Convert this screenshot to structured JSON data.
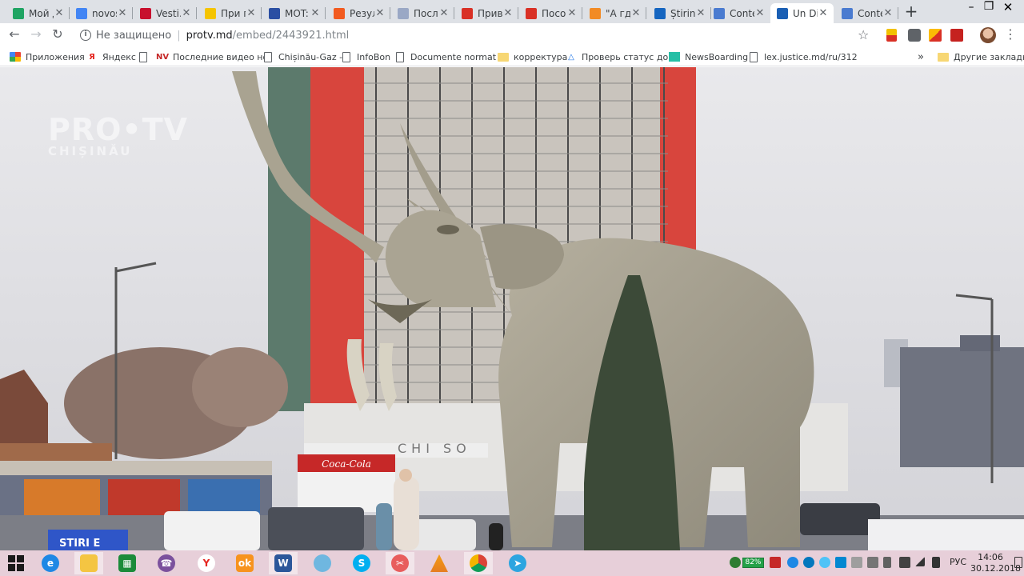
{
  "browser": {
    "tabs": [
      {
        "title": "Мой д",
        "icon": "google-drive-icon",
        "color": "#1fa463"
      },
      {
        "title": "novos",
        "icon": "google-docs-icon",
        "color": "#4285f4"
      },
      {
        "title": "Vesti.",
        "icon": "vesti-icon",
        "color": "#c8102e"
      },
      {
        "title": "При п",
        "icon": "tsn-icon",
        "color": "#f5c400"
      },
      {
        "title": "MOT:",
        "icon": "motor-icon",
        "color": "#2b4fa3"
      },
      {
        "title": "Резул",
        "icon": "orange-dot-icon",
        "color": "#f25a1f"
      },
      {
        "title": "После",
        "icon": "page-icon",
        "color": "#9aa8c5"
      },
      {
        "title": "Приві",
        "icon": "chart-icon",
        "color": "#d93025"
      },
      {
        "title": "Посо",
        "icon": "gmail-icon",
        "color": "#d93025"
      },
      {
        "title": "\"А гдє",
        "icon": "rocket-icon",
        "color": "#f28b25"
      },
      {
        "title": "Știrin",
        "icon": "stiri-icon",
        "color": "#1565c0"
      },
      {
        "title": "Conte",
        "icon": "legal-icon",
        "color": "#4a7bd0"
      },
      {
        "title": "Un Di",
        "icon": "protv-icon",
        "color": "#1a5fb4",
        "active": true
      },
      {
        "title": "Conte",
        "icon": "legal-icon",
        "color": "#4a7bd0"
      }
    ],
    "address": {
      "security_label": "Не защищено",
      "host": "protv.md",
      "path": "/embed/2443921.html"
    },
    "bookmarks": [
      {
        "label": "Приложения",
        "icon": "apps-grid-icon"
      },
      {
        "label": "Яндекс",
        "icon": "yandex-icon"
      },
      {
        "label": "",
        "icon": "page-icon"
      },
      {
        "label": "Последние видео но",
        "icon": "nv-icon"
      },
      {
        "label": "Chișinău-Gaz -",
        "icon": "page-icon"
      },
      {
        "label": "InfoBon",
        "icon": "page-icon"
      },
      {
        "label": "Documente normativ",
        "icon": "page-icon"
      },
      {
        "label": "корректура",
        "icon": "folder-icon"
      },
      {
        "label": "Проверь статус доку",
        "icon": "triangle-icon"
      },
      {
        "label": "NewsBoarding",
        "icon": "teal-square-icon"
      },
      {
        "label": "lex.justice.md/ru/312",
        "icon": "page-icon"
      }
    ],
    "bookmarks_overflow": "»",
    "other_bookmarks": "Другие закладки"
  },
  "video": {
    "watermark_line1": "PRO•TV",
    "watermark_line2": "CHIȘINĂU",
    "sign_text": "CHI SO",
    "ad_text": "Coca-Cola",
    "ticker_text": "STIRI E"
  },
  "taskbar": {
    "battery": "82%",
    "language": "РУС",
    "time": "14:06",
    "date": "30.12.2018"
  }
}
